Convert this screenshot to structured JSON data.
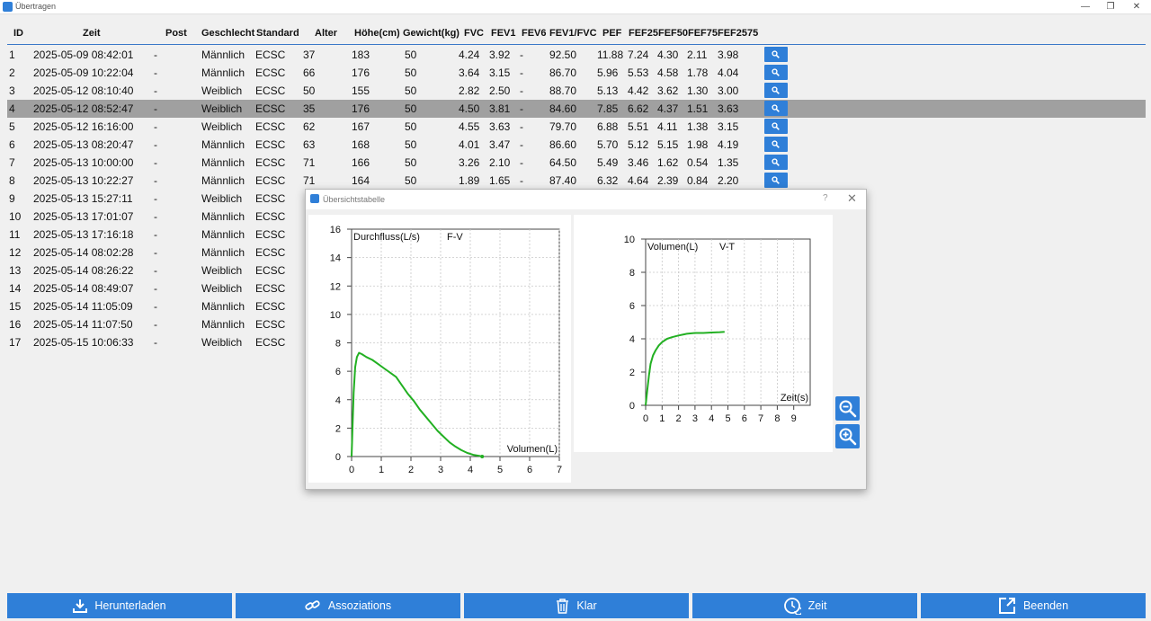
{
  "window": {
    "title": "Übertragen",
    "minimize": "—",
    "restore": "❐",
    "close": "✕"
  },
  "table": {
    "headers": [
      "ID",
      "Zeit",
      "Post",
      "Geschlecht",
      "Standard",
      "Alter",
      "Höhe(cm)",
      "Gewicht(kg)",
      "FVC",
      "FEV1",
      "FEV6",
      "FEV1/FVC",
      "PEF",
      "FEF25",
      "FEF50",
      "FEF75",
      "FEF2575"
    ],
    "selected_row": 3,
    "rows": [
      [
        "1",
        "2025-05-09 08:42:01",
        "-",
        "Männlich",
        "ECSC",
        "37",
        "183",
        "50",
        "4.24",
        "3.92",
        "-",
        "92.50",
        "11.88",
        "7.24",
        "4.30",
        "2.11",
        "3.98"
      ],
      [
        "2",
        "2025-05-09 10:22:04",
        "-",
        "Männlich",
        "ECSC",
        "66",
        "176",
        "50",
        "3.64",
        "3.15",
        "-",
        "86.70",
        "5.96",
        "5.53",
        "4.58",
        "1.78",
        "4.04"
      ],
      [
        "3",
        "2025-05-12 08:10:40",
        "-",
        "Weiblich",
        "ECSC",
        "50",
        "155",
        "50",
        "2.82",
        "2.50",
        "-",
        "88.70",
        "5.13",
        "4.42",
        "3.62",
        "1.30",
        "3.00"
      ],
      [
        "4",
        "2025-05-12 08:52:47",
        "-",
        "Weiblich",
        "ECSC",
        "35",
        "176",
        "50",
        "4.50",
        "3.81",
        "-",
        "84.60",
        "7.85",
        "6.62",
        "4.37",
        "1.51",
        "3.63"
      ],
      [
        "5",
        "2025-05-12 16:16:00",
        "-",
        "Weiblich",
        "ECSC",
        "62",
        "167",
        "50",
        "4.55",
        "3.63",
        "-",
        "79.70",
        "6.88",
        "5.51",
        "4.11",
        "1.38",
        "3.15"
      ],
      [
        "6",
        "2025-05-13 08:20:47",
        "-",
        "Männlich",
        "ECSC",
        "63",
        "168",
        "50",
        "4.01",
        "3.47",
        "-",
        "86.60",
        "5.70",
        "5.12",
        "5.15",
        "1.98",
        "4.19"
      ],
      [
        "7",
        "2025-05-13 10:00:00",
        "-",
        "Männlich",
        "ECSC",
        "71",
        "166",
        "50",
        "3.26",
        "2.10",
        "-",
        "64.50",
        "5.49",
        "3.46",
        "1.62",
        "0.54",
        "1.35"
      ],
      [
        "8",
        "2025-05-13 10:22:27",
        "-",
        "Männlich",
        "ECSC",
        "71",
        "164",
        "50",
        "1.89",
        "1.65",
        "-",
        "87.40",
        "6.32",
        "4.64",
        "2.39",
        "0.84",
        "2.20"
      ],
      [
        "9",
        "2025-05-13 15:27:11",
        "-",
        "Weiblich",
        "ECSC"
      ],
      [
        "10",
        "2025-05-13 17:01:07",
        "-",
        "Männlich",
        "ECSC"
      ],
      [
        "11",
        "2025-05-13 17:16:18",
        "-",
        "Männlich",
        "ECSC"
      ],
      [
        "12",
        "2025-05-14 08:02:28",
        "-",
        "Männlich",
        "ECSC"
      ],
      [
        "13",
        "2025-05-14 08:26:22",
        "-",
        "Weiblich",
        "ECSC"
      ],
      [
        "14",
        "2025-05-14 08:49:07",
        "-",
        "Weiblich",
        "ECSC"
      ],
      [
        "15",
        "2025-05-14 11:05:09",
        "-",
        "Männlich",
        "ECSC"
      ],
      [
        "16",
        "2025-05-14 11:07:50",
        "-",
        "Männlich",
        "ECSC"
      ],
      [
        "17",
        "2025-05-15 10:06:33",
        "-",
        "Weiblich",
        "ECSC"
      ]
    ]
  },
  "dialog": {
    "title": "Übersichtstabelle",
    "help": "?",
    "close": "✕"
  },
  "chart_data": [
    {
      "type": "line",
      "title": "F-V",
      "ylabel": "Durchfluss(L/s)",
      "xlabel": "Volumen(L)",
      "xlim": [
        0,
        7
      ],
      "ylim": [
        0,
        16
      ],
      "xticks": [
        0,
        1,
        2,
        3,
        4,
        5,
        6,
        7
      ],
      "yticks": [
        0,
        2,
        4,
        6,
        8,
        10,
        12,
        14,
        16
      ],
      "grid": true,
      "color": "#22b022",
      "x": [
        0.0,
        0.03,
        0.07,
        0.12,
        0.18,
        0.25,
        0.35,
        0.5,
        0.7,
        0.9,
        1.1,
        1.3,
        1.5,
        1.7,
        1.9,
        2.1,
        2.3,
        2.5,
        2.7,
        2.9,
        3.1,
        3.3,
        3.5,
        3.7,
        3.9,
        4.1,
        4.3,
        4.4
      ],
      "y": [
        0.0,
        2.0,
        4.5,
        6.3,
        7.0,
        7.3,
        7.2,
        7.0,
        6.8,
        6.5,
        6.2,
        5.9,
        5.6,
        5.0,
        4.4,
        3.9,
        3.3,
        2.8,
        2.3,
        1.8,
        1.4,
        1.0,
        0.7,
        0.45,
        0.25,
        0.12,
        0.05,
        0.0
      ]
    },
    {
      "type": "line",
      "title": "V-T",
      "ylabel": "Volumen(L)",
      "xlabel": "Zeit(s)",
      "xlim": [
        0,
        10
      ],
      "ylim": [
        0,
        10
      ],
      "xticks": [
        0,
        1,
        2,
        3,
        4,
        5,
        6,
        7,
        8,
        9
      ],
      "yticks": [
        0,
        2,
        4,
        6,
        8,
        10
      ],
      "grid": true,
      "color": "#22b022",
      "x": [
        0.0,
        0.1,
        0.2,
        0.3,
        0.45,
        0.6,
        0.8,
        1.0,
        1.3,
        1.6,
        2.0,
        2.5,
        3.0,
        3.5,
        4.0,
        4.5,
        4.8
      ],
      "y": [
        0.0,
        0.9,
        1.8,
        2.5,
        3.0,
        3.3,
        3.6,
        3.8,
        4.0,
        4.1,
        4.2,
        4.3,
        4.35,
        4.35,
        4.38,
        4.4,
        4.42
      ]
    }
  ],
  "bottom_bar": {
    "download": "Herunterladen",
    "assoc": "Assoziations",
    "clear": "Klar",
    "time": "Zeit",
    "exit": "Beenden"
  }
}
